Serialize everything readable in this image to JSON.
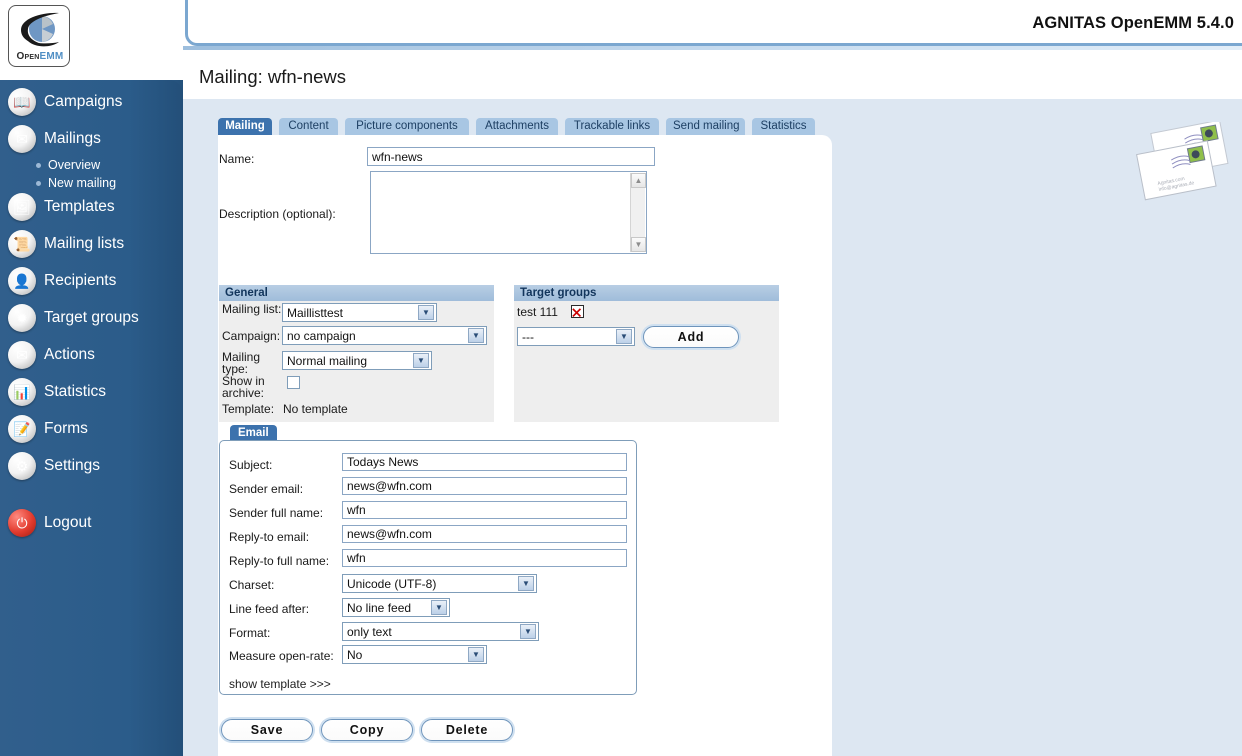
{
  "brand": {
    "logo_open": "Open",
    "logo_emm": "EMM",
    "app_title": "AGNITAS OpenEMM 5.4.0"
  },
  "colors": {
    "sidebar_bg": "#2b5c8a",
    "content_bg": "#dde7f2",
    "tab_active": "#3c72ad",
    "tab_inactive": "#a8c6e3",
    "panel_head": "#9fbcda",
    "delete_icon": "#cc0000"
  },
  "sidebar": {
    "items": [
      {
        "label": "Campaigns",
        "icon": "campaigns-icon",
        "glyph": "📖"
      },
      {
        "label": "Mailings",
        "icon": "mailings-icon",
        "glyph": "✉"
      },
      {
        "label": "Templates",
        "icon": "templates-icon",
        "glyph": "🖼"
      },
      {
        "label": "Mailing lists",
        "icon": "mailing-lists-icon",
        "glyph": "📜"
      },
      {
        "label": "Recipients",
        "icon": "recipients-icon",
        "glyph": "👤"
      },
      {
        "label": "Target groups",
        "icon": "target-groups-icon",
        "glyph": "✹"
      },
      {
        "label": "Actions",
        "icon": "actions-icon",
        "glyph": "✉"
      },
      {
        "label": "Statistics",
        "icon": "statistics-icon",
        "glyph": "📊"
      },
      {
        "label": "Forms",
        "icon": "forms-icon",
        "glyph": "📝"
      },
      {
        "label": "Settings",
        "icon": "settings-icon",
        "glyph": "⚙"
      },
      {
        "label": "Logout",
        "icon": "logout-icon",
        "glyph": "⛔"
      }
    ],
    "sub_items": [
      {
        "label": "Overview"
      },
      {
        "label": "New mailing"
      }
    ]
  },
  "page": {
    "title": "Mailing: wfn-news"
  },
  "tabs": [
    {
      "label": "Mailing",
      "active": true
    },
    {
      "label": "Content",
      "active": false
    },
    {
      "label": "Picture components",
      "active": false
    },
    {
      "label": "Attachments",
      "active": false
    },
    {
      "label": "Trackable links",
      "active": false
    },
    {
      "label": "Send mailing",
      "active": false
    },
    {
      "label": "Statistics",
      "active": false
    }
  ],
  "form": {
    "name_label": "Name:",
    "name_value": "wfn-news",
    "description_label": "Description (optional):",
    "description_value": ""
  },
  "general": {
    "title": "General",
    "mailing_list_label": "Mailing list:",
    "mailing_list_value": "Maillisttest",
    "campaign_label": "Campaign:",
    "campaign_value": "no campaign",
    "mailing_type_label": "Mailing type:",
    "mailing_type_value": "Normal mailing",
    "show_in_archive_label": "Show in archive:",
    "show_in_archive_checked": false,
    "template_label": "Template:",
    "template_value": "No template"
  },
  "target_groups": {
    "title": "Target groups",
    "assigned": [
      {
        "name": "test 111",
        "delete_icon": "delete-x-icon"
      }
    ],
    "select_value": "---",
    "add_button": "Add"
  },
  "email": {
    "tab_label": "Email",
    "fields": [
      {
        "label": "Subject:",
        "value": "Todays News",
        "type": "text"
      },
      {
        "label": "Sender email:",
        "value": "news@wfn.com",
        "type": "text"
      },
      {
        "label": "Sender full name:",
        "value": "wfn",
        "type": "text"
      },
      {
        "label": "Reply-to email:",
        "value": "news@wfn.com",
        "type": "text"
      },
      {
        "label": "Reply-to full name:",
        "value": "wfn",
        "type": "text"
      },
      {
        "label": "Charset:",
        "value": "Unicode (UTF-8)",
        "type": "select"
      },
      {
        "label": "Line feed after:",
        "value": "No line feed",
        "type": "select"
      },
      {
        "label": "Format:",
        "value": "only text",
        "type": "select"
      },
      {
        "label": "Measure open-rate:",
        "value": "No",
        "type": "select"
      }
    ],
    "show_template_link": "show template >>>"
  },
  "actions": {
    "save": "Save",
    "copy": "Copy",
    "delete": "Delete"
  }
}
